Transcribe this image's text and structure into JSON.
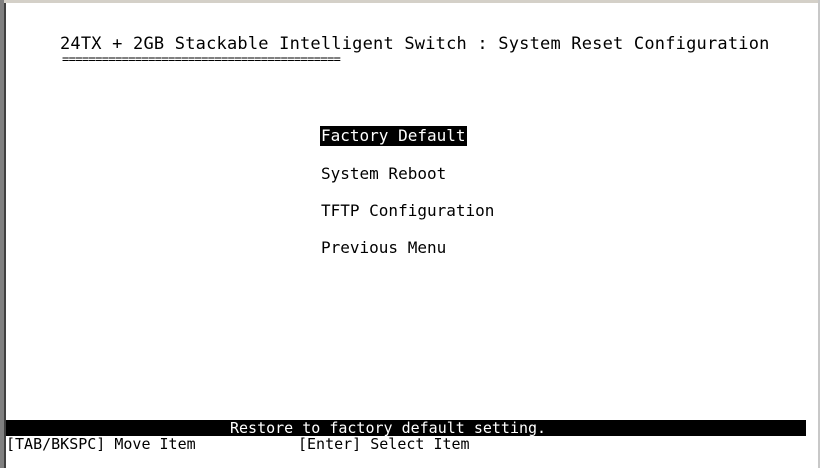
{
  "screen": {
    "title": "24TX + 2GB Stackable Intelligent Switch : System Reset Configuration",
    "title_underline": "=========================================="
  },
  "menu": {
    "items": [
      {
        "label": "Factory Default",
        "selected": true
      },
      {
        "label": "System Reboot",
        "selected": false
      },
      {
        "label": "TFTP Configuration",
        "selected": false
      },
      {
        "label": "Previous Menu",
        "selected": false
      }
    ]
  },
  "status": {
    "message": "Restore to factory default setting."
  },
  "help": {
    "move": "[TAB/BKSPC] Move Item",
    "select": "[Enter] Select Item"
  },
  "colors": {
    "background": "#ffffff",
    "text": "#000000",
    "highlight_bg": "#000000",
    "highlight_text": "#ffffff"
  }
}
